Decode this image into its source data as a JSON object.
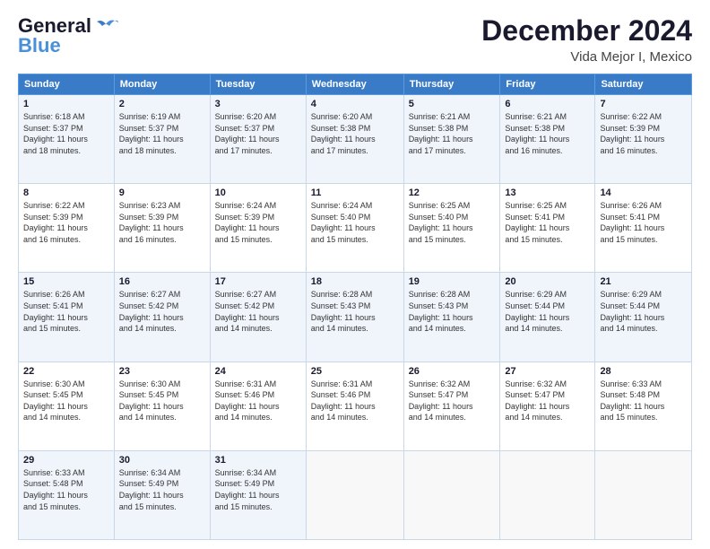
{
  "logo": {
    "line1": "General",
    "line2": "Blue"
  },
  "header": {
    "month": "December 2024",
    "location": "Vida Mejor I, Mexico"
  },
  "days_of_week": [
    "Sunday",
    "Monday",
    "Tuesday",
    "Wednesday",
    "Thursday",
    "Friday",
    "Saturday"
  ],
  "weeks": [
    [
      {
        "day": "1",
        "info": "Sunrise: 6:18 AM\nSunset: 5:37 PM\nDaylight: 11 hours\nand 18 minutes."
      },
      {
        "day": "2",
        "info": "Sunrise: 6:19 AM\nSunset: 5:37 PM\nDaylight: 11 hours\nand 18 minutes."
      },
      {
        "day": "3",
        "info": "Sunrise: 6:20 AM\nSunset: 5:37 PM\nDaylight: 11 hours\nand 17 minutes."
      },
      {
        "day": "4",
        "info": "Sunrise: 6:20 AM\nSunset: 5:38 PM\nDaylight: 11 hours\nand 17 minutes."
      },
      {
        "day": "5",
        "info": "Sunrise: 6:21 AM\nSunset: 5:38 PM\nDaylight: 11 hours\nand 17 minutes."
      },
      {
        "day": "6",
        "info": "Sunrise: 6:21 AM\nSunset: 5:38 PM\nDaylight: 11 hours\nand 16 minutes."
      },
      {
        "day": "7",
        "info": "Sunrise: 6:22 AM\nSunset: 5:39 PM\nDaylight: 11 hours\nand 16 minutes."
      }
    ],
    [
      {
        "day": "8",
        "info": "Sunrise: 6:22 AM\nSunset: 5:39 PM\nDaylight: 11 hours\nand 16 minutes."
      },
      {
        "day": "9",
        "info": "Sunrise: 6:23 AM\nSunset: 5:39 PM\nDaylight: 11 hours\nand 16 minutes."
      },
      {
        "day": "10",
        "info": "Sunrise: 6:24 AM\nSunset: 5:39 PM\nDaylight: 11 hours\nand 15 minutes."
      },
      {
        "day": "11",
        "info": "Sunrise: 6:24 AM\nSunset: 5:40 PM\nDaylight: 11 hours\nand 15 minutes."
      },
      {
        "day": "12",
        "info": "Sunrise: 6:25 AM\nSunset: 5:40 PM\nDaylight: 11 hours\nand 15 minutes."
      },
      {
        "day": "13",
        "info": "Sunrise: 6:25 AM\nSunset: 5:41 PM\nDaylight: 11 hours\nand 15 minutes."
      },
      {
        "day": "14",
        "info": "Sunrise: 6:26 AM\nSunset: 5:41 PM\nDaylight: 11 hours\nand 15 minutes."
      }
    ],
    [
      {
        "day": "15",
        "info": "Sunrise: 6:26 AM\nSunset: 5:41 PM\nDaylight: 11 hours\nand 15 minutes."
      },
      {
        "day": "16",
        "info": "Sunrise: 6:27 AM\nSunset: 5:42 PM\nDaylight: 11 hours\nand 14 minutes."
      },
      {
        "day": "17",
        "info": "Sunrise: 6:27 AM\nSunset: 5:42 PM\nDaylight: 11 hours\nand 14 minutes."
      },
      {
        "day": "18",
        "info": "Sunrise: 6:28 AM\nSunset: 5:43 PM\nDaylight: 11 hours\nand 14 minutes."
      },
      {
        "day": "19",
        "info": "Sunrise: 6:28 AM\nSunset: 5:43 PM\nDaylight: 11 hours\nand 14 minutes."
      },
      {
        "day": "20",
        "info": "Sunrise: 6:29 AM\nSunset: 5:44 PM\nDaylight: 11 hours\nand 14 minutes."
      },
      {
        "day": "21",
        "info": "Sunrise: 6:29 AM\nSunset: 5:44 PM\nDaylight: 11 hours\nand 14 minutes."
      }
    ],
    [
      {
        "day": "22",
        "info": "Sunrise: 6:30 AM\nSunset: 5:45 PM\nDaylight: 11 hours\nand 14 minutes."
      },
      {
        "day": "23",
        "info": "Sunrise: 6:30 AM\nSunset: 5:45 PM\nDaylight: 11 hours\nand 14 minutes."
      },
      {
        "day": "24",
        "info": "Sunrise: 6:31 AM\nSunset: 5:46 PM\nDaylight: 11 hours\nand 14 minutes."
      },
      {
        "day": "25",
        "info": "Sunrise: 6:31 AM\nSunset: 5:46 PM\nDaylight: 11 hours\nand 14 minutes."
      },
      {
        "day": "26",
        "info": "Sunrise: 6:32 AM\nSunset: 5:47 PM\nDaylight: 11 hours\nand 14 minutes."
      },
      {
        "day": "27",
        "info": "Sunrise: 6:32 AM\nSunset: 5:47 PM\nDaylight: 11 hours\nand 14 minutes."
      },
      {
        "day": "28",
        "info": "Sunrise: 6:33 AM\nSunset: 5:48 PM\nDaylight: 11 hours\nand 15 minutes."
      }
    ],
    [
      {
        "day": "29",
        "info": "Sunrise: 6:33 AM\nSunset: 5:48 PM\nDaylight: 11 hours\nand 15 minutes."
      },
      {
        "day": "30",
        "info": "Sunrise: 6:34 AM\nSunset: 5:49 PM\nDaylight: 11 hours\nand 15 minutes."
      },
      {
        "day": "31",
        "info": "Sunrise: 6:34 AM\nSunset: 5:49 PM\nDaylight: 11 hours\nand 15 minutes."
      },
      null,
      null,
      null,
      null
    ]
  ]
}
